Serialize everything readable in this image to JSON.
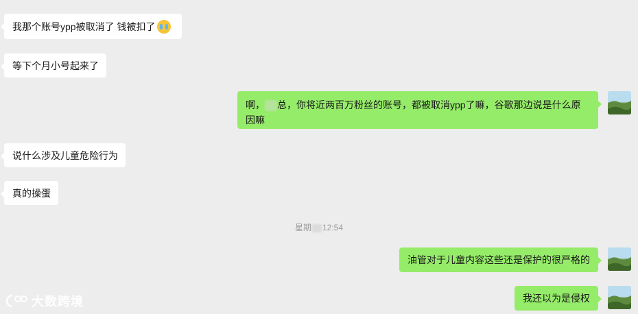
{
  "messages": [
    {
      "side": "in",
      "text": "我那个账号ypp被取消了  钱被扣了",
      "emoji": "crying-face"
    },
    {
      "side": "in",
      "text": "等下个月小号起来了"
    },
    {
      "side": "out",
      "text_prefix": "啊，",
      "text_redacted": "总",
      "text_suffix": "，你将近两百万粉丝的账号，都被取消ypp了嘛，谷歌那边说是什么原因嘛"
    },
    {
      "side": "in",
      "text": "说什么涉及儿童危险行为"
    },
    {
      "side": "in",
      "text": "真的操蛋"
    },
    {
      "side": "out",
      "text": "油管对于儿童内容这些还是保护的很严格的"
    },
    {
      "side": "out",
      "text": "我还以为是侵权"
    }
  ],
  "timestamp": {
    "prefix": "星期",
    "time": "12:54"
  },
  "watermark": {
    "text": "大数跨境"
  },
  "colors": {
    "background": "#ededed",
    "incoming_bubble": "#ffffff",
    "outgoing_bubble": "#95ec69"
  }
}
